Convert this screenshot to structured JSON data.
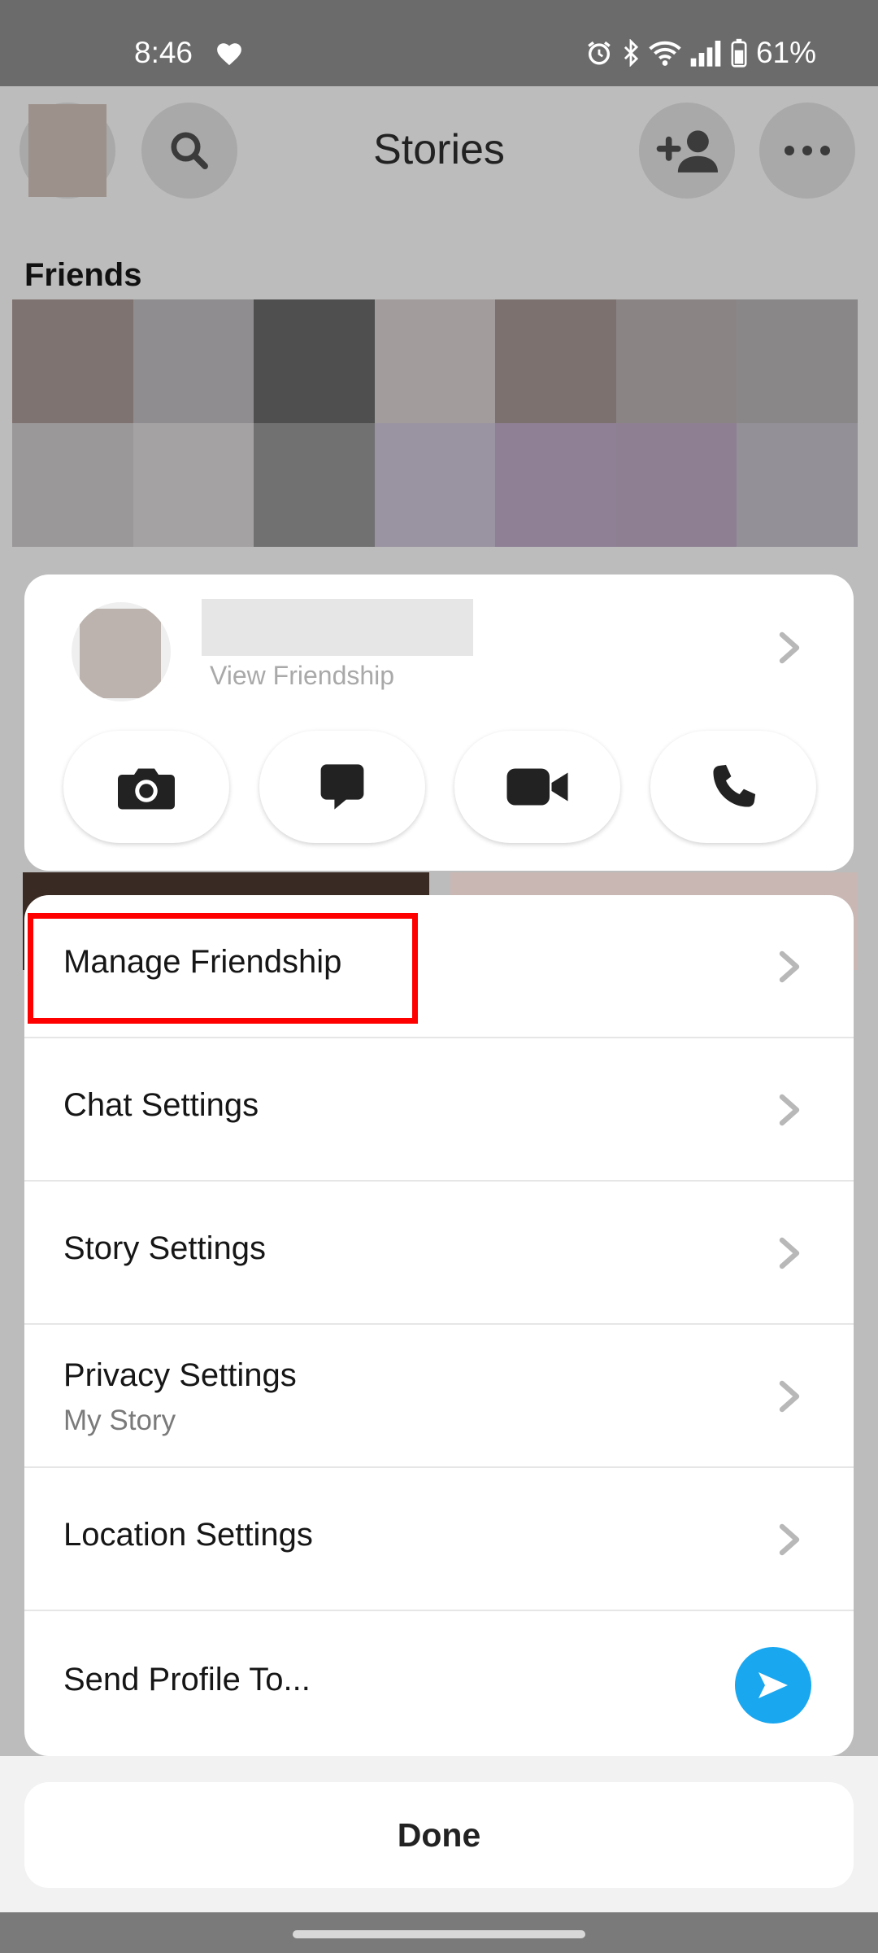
{
  "status_bar": {
    "time": "8:46",
    "battery": "61%"
  },
  "background_app": {
    "title": "Stories",
    "section_label": "Friends",
    "mosaic_colors": [
      "#7f7371",
      "#8f8d8f",
      "#4f4f4f",
      "#a29c9c",
      "#7d716f",
      "#8a8484",
      "#898788",
      "#9b9899",
      "#a4a2a3",
      "#727172",
      "#9a93a1",
      "#8f8096",
      "#8e8092",
      "#939097"
    ]
  },
  "profile_card": {
    "subtitle": "View Friendship",
    "actions": [
      {
        "name": "camera-button",
        "icon": "camera-icon"
      },
      {
        "name": "chat-button",
        "icon": "chat-icon"
      },
      {
        "name": "video-call-button",
        "icon": "video-icon"
      },
      {
        "name": "voice-call-button",
        "icon": "phone-icon"
      }
    ]
  },
  "menu": {
    "items": [
      {
        "label": "Manage Friendship"
      },
      {
        "label": "Chat Settings"
      },
      {
        "label": "Story Settings"
      },
      {
        "label": "Privacy Settings",
        "sublabel": "My Story"
      },
      {
        "label": "Location Settings"
      },
      {
        "label": "Send Profile To..."
      }
    ]
  },
  "done_label": "Done",
  "colors": {
    "send_blue": "#19a7f0",
    "highlight_red": "#ff0000"
  }
}
